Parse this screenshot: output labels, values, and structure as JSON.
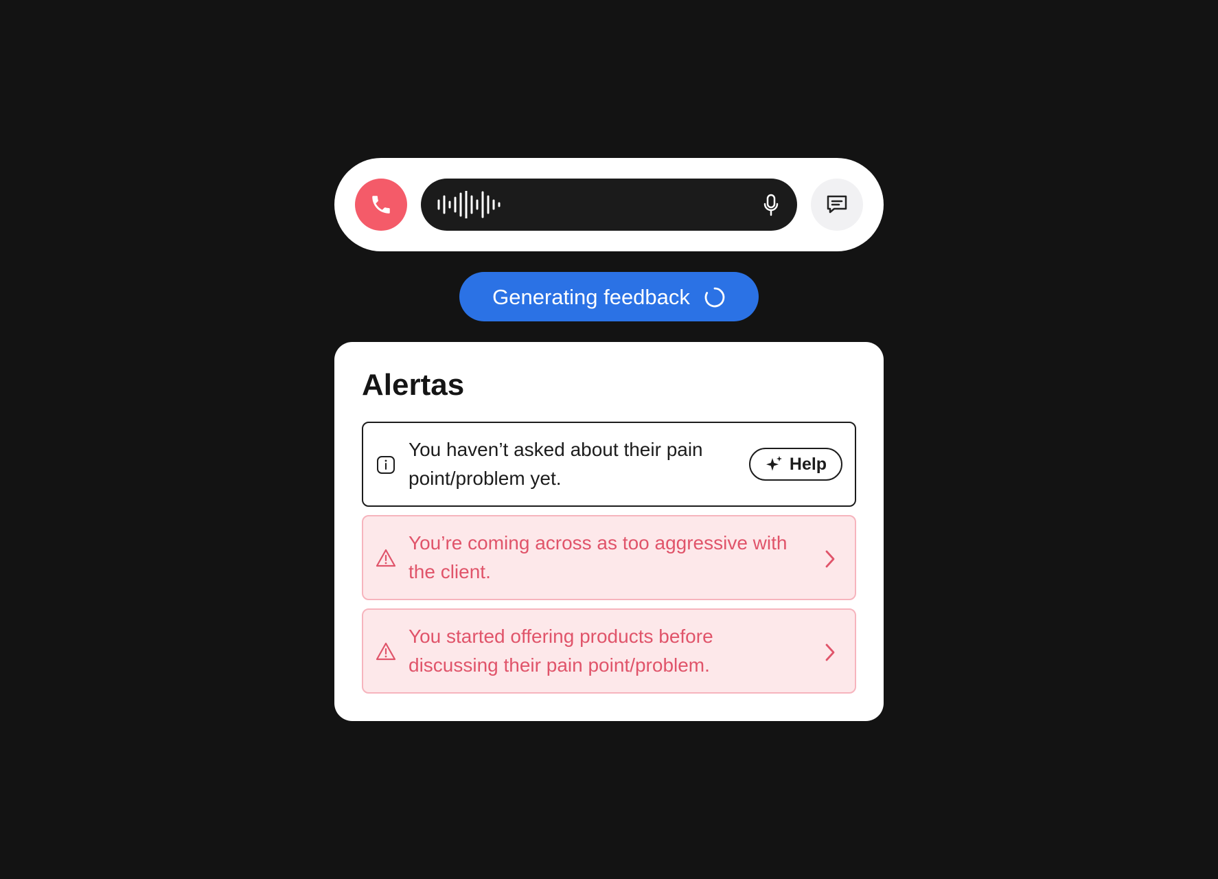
{
  "call_bar": {
    "end_call_icon": "phone-icon",
    "waveform_icon": "audio-waveform-icon",
    "mic_icon": "microphone-icon",
    "chat_icon": "chat-icon"
  },
  "status_pill": {
    "label": "Generating feedback",
    "icon": "loading-spinner-icon"
  },
  "alerts": {
    "title": "Alertas",
    "items": [
      {
        "type": "info",
        "icon": "info-icon",
        "text": "You haven’t asked about their pain point/problem yet.",
        "action_label": "Help",
        "action_icon": "sparkle-icon"
      },
      {
        "type": "warning",
        "icon": "warning-triangle-icon",
        "text": "You’re coming across as too aggressive with the client.",
        "action_icon": "chevron-right-icon"
      },
      {
        "type": "warning",
        "icon": "warning-triangle-icon",
        "text": "You started offering products before discussing their pain point/problem.",
        "action_icon": "chevron-right-icon"
      }
    ]
  },
  "colors": {
    "background": "#131313",
    "end_call": "#f45b69",
    "status_pill": "#2b72e5",
    "warning_text": "#e0546a",
    "warning_bg": "#fde8ea",
    "warning_border": "#f6b4bd"
  }
}
